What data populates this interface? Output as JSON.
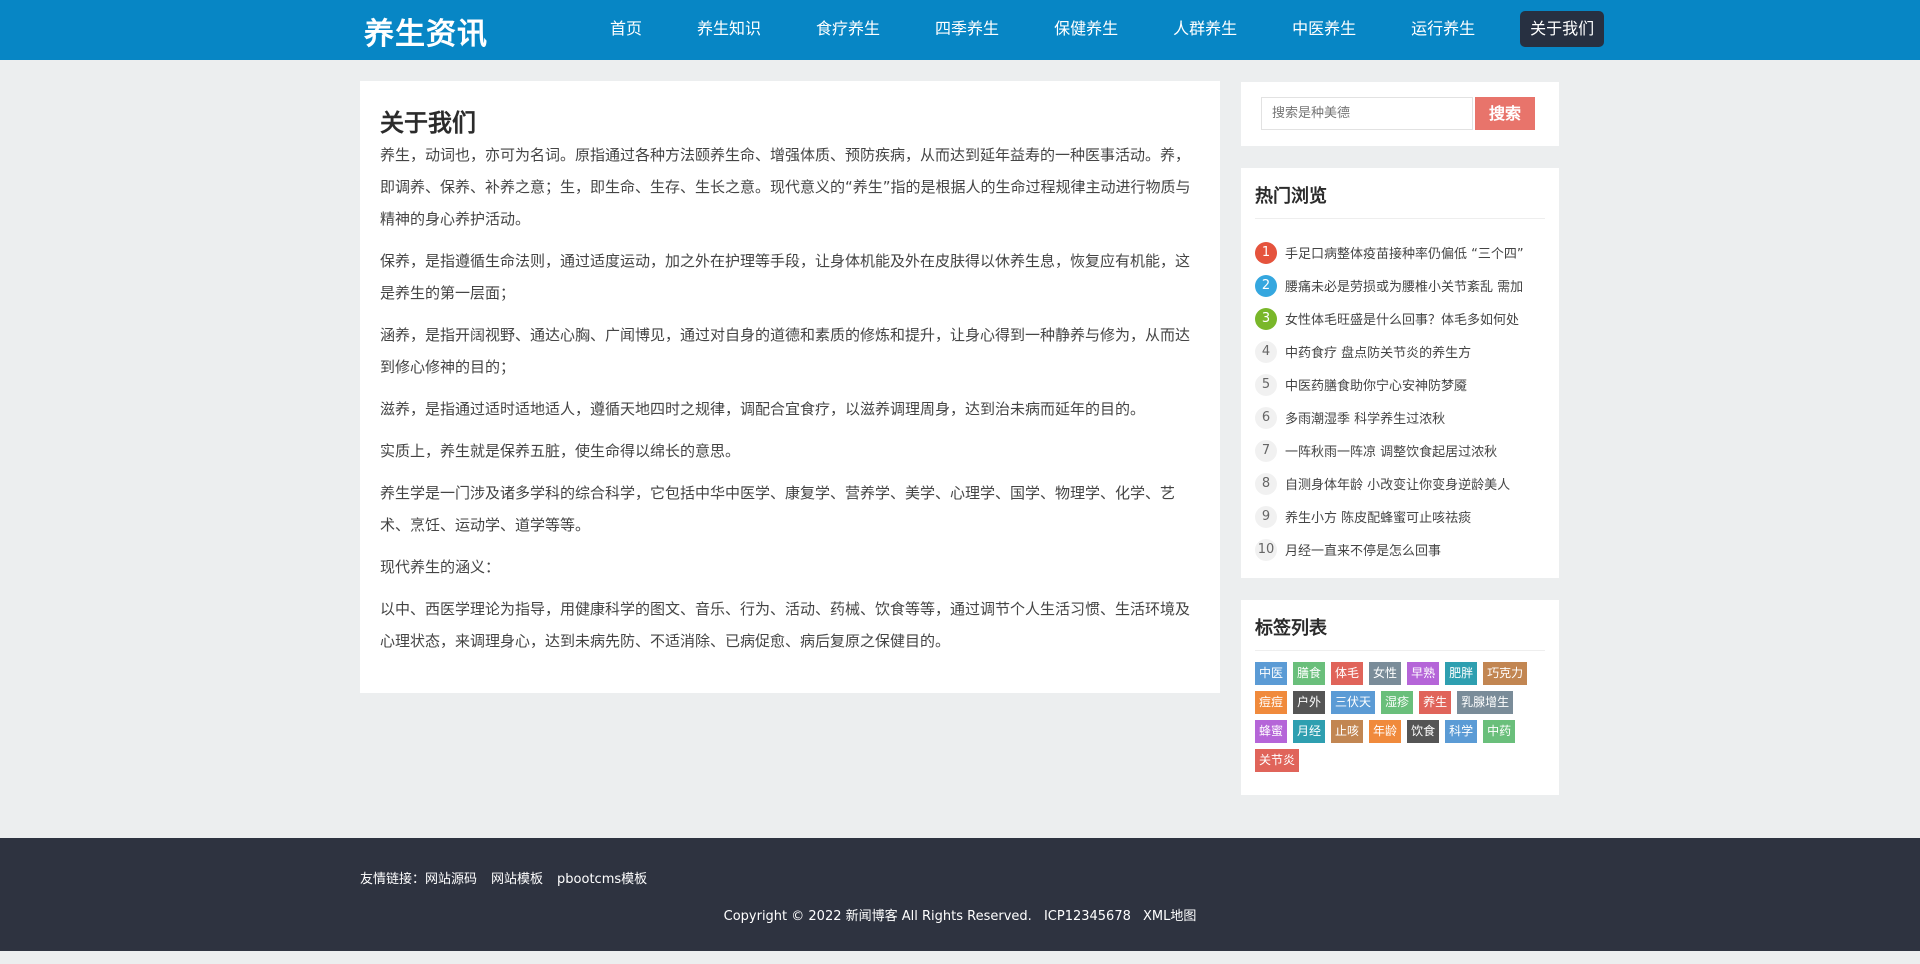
{
  "header": {
    "brand": "养生资讯",
    "nav": [
      "首页",
      "养生知识",
      "食疗养生",
      "四季养生",
      "保健养生",
      "人群养生",
      "中医养生",
      "运行养生"
    ],
    "nav_active": "关于我们"
  },
  "main": {
    "title": "关于我们",
    "paragraphs": [
      "养生，动词也，亦可为名词。原指通过各种方法颐养生命、增强体质、预防疾病，从而达到延年益寿的一种医事活动。养，即调养、保养、补养之意；生，即生命、生存、生长之意。现代意义的“养生”指的是根据人的生命过程规律主动进行物质与精神的身心养护活动。",
      "保养，是指遵循生命法则，通过适度运动，加之外在护理等手段，让身体机能及外在皮肤得以休养生息，恢复应有机能，这是养生的第一层面；",
      "涵养，是指开阔视野、通达心胸、广闻博见，通过对自身的道德和素质的修炼和提升，让身心得到一种静养与修为，从而达到修心修神的目的；",
      "滋养，是指通过适时适地适人，遵循天地四时之规律，调配合宜食疗，以滋养调理周身，达到治未病而延年的目的。",
      "实质上，养生就是保养五脏，使生命得以绵长的意思。",
      "养生学是一门涉及诸多学科的综合科学，它包括中华中医学、康复学、营养学、美学、心理学、国学、物理学、化学、艺术、烹饪、运动学、道学等等。",
      "现代养生的涵义：",
      "以中、西医学理论为指导，用健康科学的图文、音乐、行为、活动、药械、饮食等等，通过调节个人生活习惯、生活环境及心理状态，来调理身心，达到未病先防、不适消除、已病促愈、病后复原之保健目的。"
    ]
  },
  "search": {
    "placeholder": "搜索是种美德",
    "button": "搜索"
  },
  "hot": {
    "title": "热门浏览",
    "items": [
      {
        "num": "1",
        "text": "手足口病整体疫苗接种率仍偏低 “三个四”",
        "color": "#e5533d"
      },
      {
        "num": "2",
        "text": "腰痛未必是劳损或为腰椎小关节紊乱 需加",
        "color": "#35a7df"
      },
      {
        "num": "3",
        "text": "女性体毛旺盛是什么回事？体毛多如何处",
        "color": "#79b72a"
      },
      {
        "num": "4",
        "text": "中药食疗 盘点防关节炎的养生方",
        "color": ""
      },
      {
        "num": "5",
        "text": "中医药膳食助你宁心安神防梦魇",
        "color": ""
      },
      {
        "num": "6",
        "text": "多雨潮湿季 科学养生过浓秋",
        "color": ""
      },
      {
        "num": "7",
        "text": "一阵秋雨一阵凉 调整饮食起居过浓秋",
        "color": ""
      },
      {
        "num": "8",
        "text": "自测身体年龄 小改变让你变身逆龄美人",
        "color": ""
      },
      {
        "num": "9",
        "text": "养生小方 陈皮配蜂蜜可止咳祛痰",
        "color": ""
      },
      {
        "num": "10",
        "text": "月经一直来不停是怎么回事",
        "color": ""
      }
    ]
  },
  "tags": {
    "title": "标签列表",
    "items": [
      {
        "label": "中医",
        "color": "#5b9bd5"
      },
      {
        "label": "膳食",
        "color": "#6abf7b"
      },
      {
        "label": "体毛",
        "color": "#e0645a"
      },
      {
        "label": "女性",
        "color": "#7a8c99"
      },
      {
        "label": "早熟",
        "color": "#b565d8"
      },
      {
        "label": "肥胖",
        "color": "#2e9fb0"
      },
      {
        "label": "巧克力",
        "color": "#c28652"
      },
      {
        "label": "痘痘",
        "color": "#f08a3c"
      },
      {
        "label": "户外",
        "color": "#555555"
      },
      {
        "label": "三伏天",
        "color": "#5b9bd5"
      },
      {
        "label": "湿疹",
        "color": "#6abf7b"
      },
      {
        "label": "养生",
        "color": "#e0645a"
      },
      {
        "label": "乳腺增生",
        "color": "#7a8c99"
      },
      {
        "label": "蜂蜜",
        "color": "#b565d8"
      },
      {
        "label": "月经",
        "color": "#2e9fb0"
      },
      {
        "label": "止咳",
        "color": "#c28652"
      },
      {
        "label": "年龄",
        "color": "#f08a3c"
      },
      {
        "label": "饮食",
        "color": "#555555"
      },
      {
        "label": "科学",
        "color": "#5b9bd5"
      },
      {
        "label": "中药",
        "color": "#6abf7b"
      },
      {
        "label": "关节炎",
        "color": "#e0645a"
      }
    ]
  },
  "footer": {
    "links_label": "友情链接：",
    "links": [
      "网站源码",
      "网站模板",
      "pbootcms模板"
    ],
    "copyright": "Copyright © 2022 新闻博客 All Rights Reserved.",
    "icp": "ICP12345678",
    "sitemap": "XML地图"
  }
}
